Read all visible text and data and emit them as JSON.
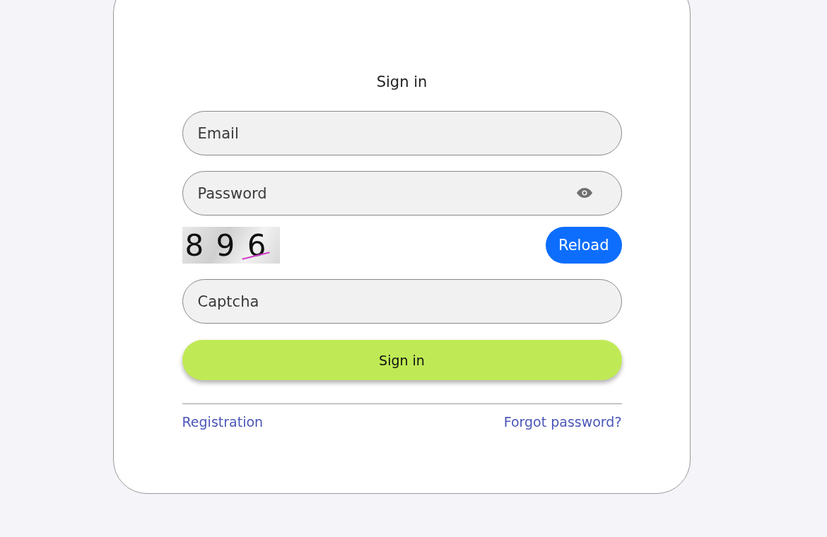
{
  "title": "Sign in",
  "fields": [
    {
      "kind": "email",
      "placeholder": "Email"
    },
    {
      "kind": "password",
      "placeholder": "Password"
    }
  ],
  "captcha": {
    "text": "8 9 6",
    "reload": "Reload",
    "placeholder": "Captcha"
  },
  "submit": "Sign in",
  "links": [
    "Registration",
    "Forgot password?"
  ]
}
